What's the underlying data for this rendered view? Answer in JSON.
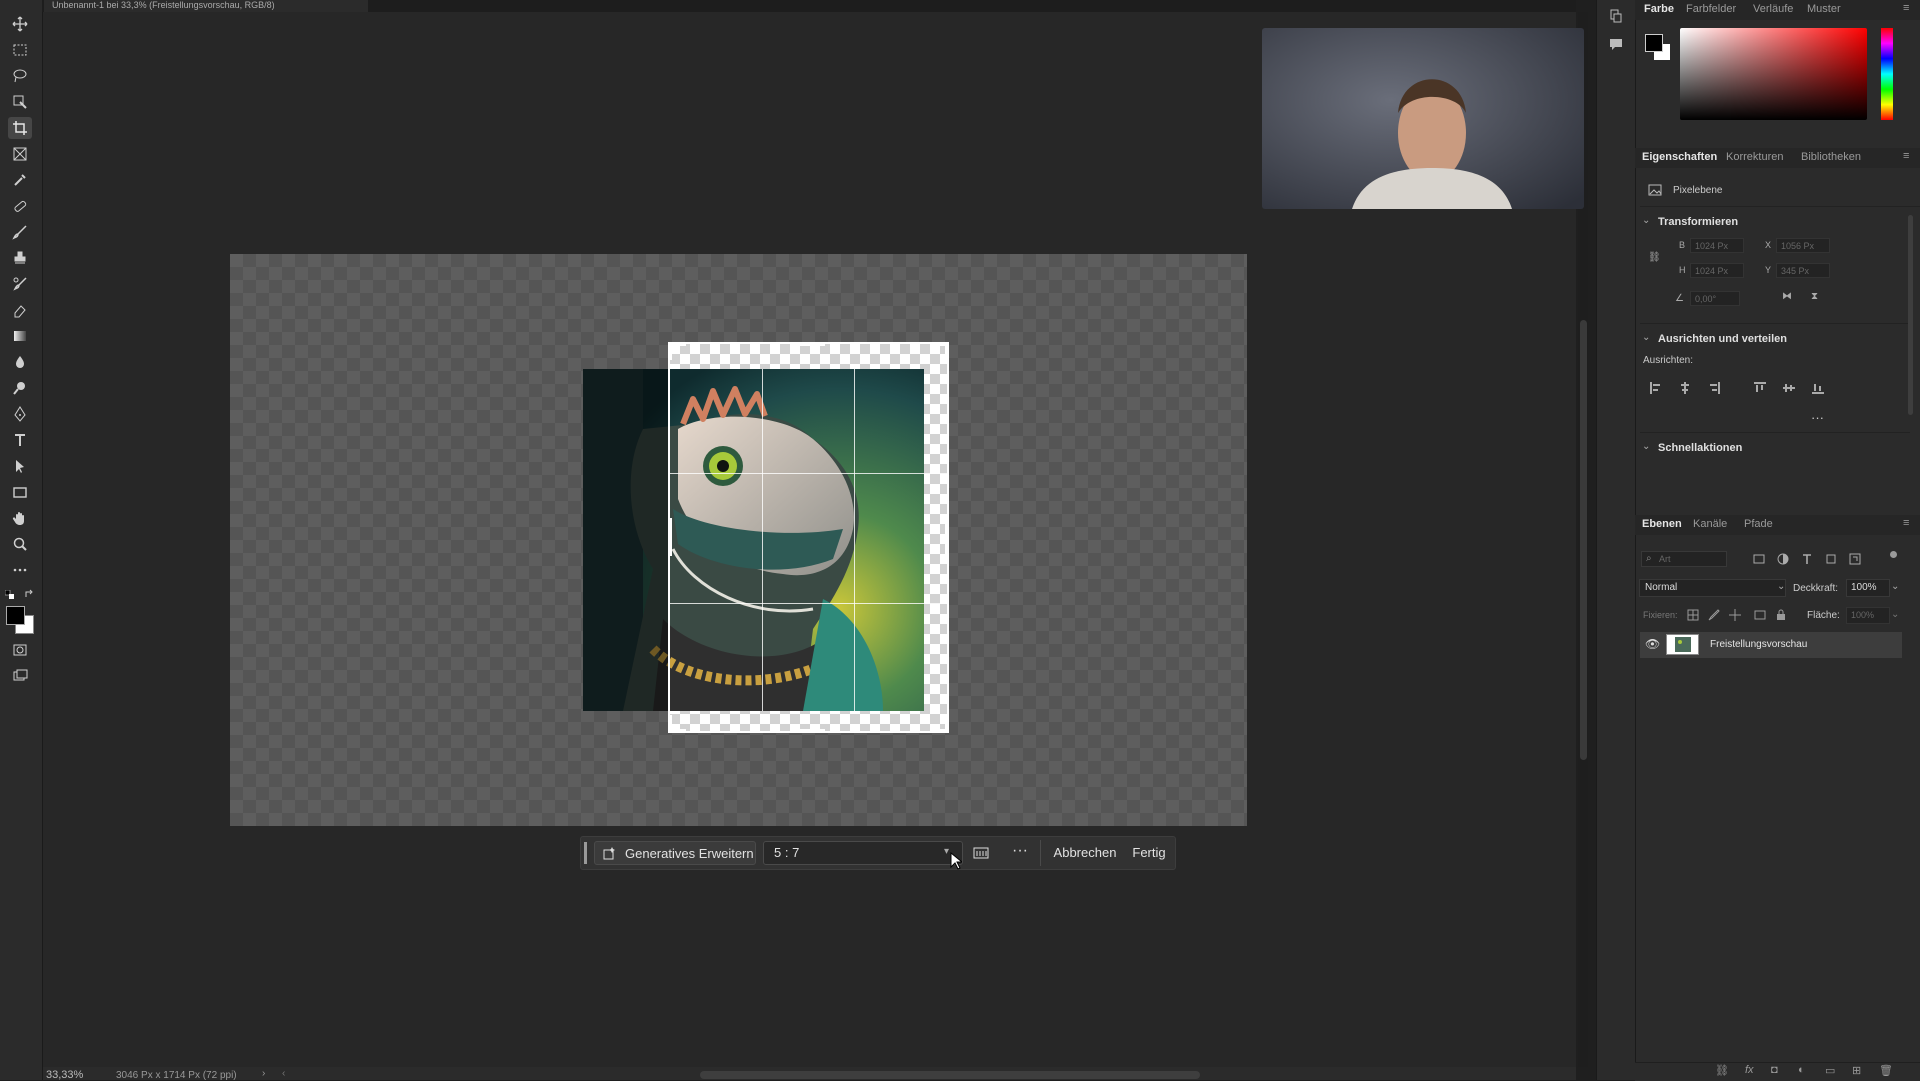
{
  "document": {
    "tab_title": "Unbenannt-1 bei 33,3% (Freistellungsvorschau, RGB/8)",
    "zoom": "33,33%",
    "size": "3046 Px x 1714 Px (72 ppi)"
  },
  "taskbar": {
    "generative_expand_label": "Generatives Erweitern",
    "ratio_value": "5 : 7",
    "more_label": "···",
    "cancel_label": "Abbrechen",
    "done_label": "Fertig"
  },
  "color_panel": {
    "tabs": [
      "Farbe",
      "Farbfelder",
      "Verläufe",
      "Muster"
    ]
  },
  "properties_panel": {
    "tabs": [
      "Eigenschaften",
      "Korrekturen",
      "Bibliotheken"
    ],
    "layer_type": "Pixelebene",
    "transform_title": "Transformieren",
    "w_label": "B",
    "w_value": "1024 Px",
    "h_label": "H",
    "h_value": "1024 Px",
    "x_label": "X",
    "x_value": "1056 Px",
    "y_label": "Y",
    "y_value": "345 Px",
    "angle_value": "0,00°",
    "align_title": "Ausrichten und verteilen",
    "align_label": "Ausrichten:",
    "quick_actions_title": "Schnellaktionen",
    "more_label": "···"
  },
  "layers_panel": {
    "tabs": [
      "Ebenen",
      "Kanäle",
      "Pfade"
    ],
    "search_placeholder": "Art",
    "blend_mode": "Normal",
    "opacity_label": "Deckkraft:",
    "opacity_value": "100%",
    "lock_label": "Fixieren:",
    "fill_label": "Fläche:",
    "fill_value": "100%",
    "layers": [
      {
        "name": "Freistellungsvorschau",
        "visible": true
      }
    ]
  },
  "colors": {
    "accent": "#4a90e2",
    "foreground": "#000000",
    "background": "#ffffff"
  }
}
